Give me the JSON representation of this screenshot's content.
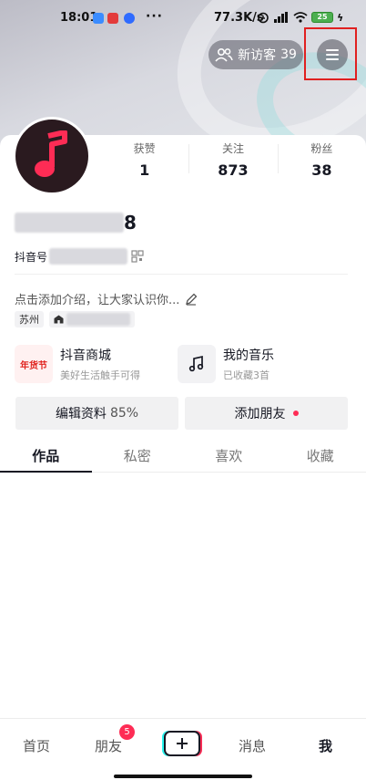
{
  "status_bar": {
    "time": "18:01",
    "dots": "···",
    "speed": "77.3K/s",
    "battery": "25"
  },
  "header": {
    "visitor_label": "新访客",
    "visitor_count": "39"
  },
  "profile": {
    "stats": [
      {
        "label": "获赞",
        "value": "1"
      },
      {
        "label": "关注",
        "value": "873"
      },
      {
        "label": "粉丝",
        "value": "38"
      }
    ],
    "username_visible": "8",
    "douyin_id_label": "抖音号",
    "bio_placeholder": "点击添加介绍，让大家认识你...",
    "location_tag": "苏州"
  },
  "features": [
    {
      "icon_text": "年货节",
      "title": "抖音商城",
      "subtitle": "美好生活触手可得"
    },
    {
      "title": "我的音乐",
      "subtitle": "已收藏3首"
    }
  ],
  "actions": {
    "edit_label": "编辑资料",
    "edit_percent": "85%",
    "add_friend_label": "添加朋友"
  },
  "tabs": [
    "作品",
    "私密",
    "喜欢",
    "收藏"
  ],
  "bottom_nav": {
    "home": "首页",
    "friends": "朋友",
    "friends_badge": "5",
    "messages": "消息",
    "me": "我"
  },
  "colors": {
    "accent": "#fe2c55",
    "text_primary": "#161823",
    "highlight_box": "#e02020"
  }
}
